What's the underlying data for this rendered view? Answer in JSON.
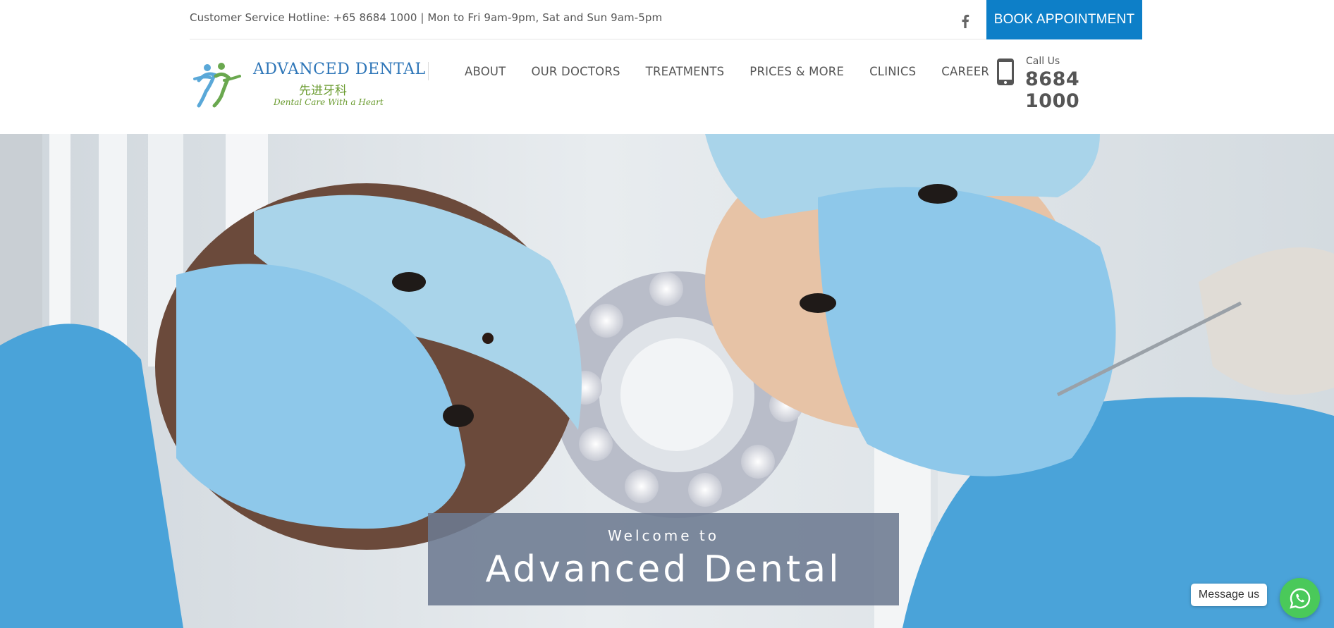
{
  "topbar": {
    "hotline": "Customer Service Hotline: +65 8684 1000 | Mon to Fri 9am-9pm, Sat and Sun 9am-5pm",
    "social_icon": "facebook-icon",
    "book_label": "BOOK APPOINTMENT"
  },
  "header": {
    "logo": {
      "name": "ADVANCED DENTAL",
      "chinese": "先进牙科",
      "tagline": "Dental Care With a Heart"
    },
    "nav": [
      {
        "label": "ABOUT"
      },
      {
        "label": "OUR DOCTORS"
      },
      {
        "label": "TREATMENTS"
      },
      {
        "label": "PRICES & MORE"
      },
      {
        "label": "CLINICS"
      },
      {
        "label": "CAREER"
      }
    ],
    "call": {
      "icon": "mobile-phone-icon",
      "label": "Call Us",
      "number": "8684 1000"
    }
  },
  "hero": {
    "welcome_small": "Welcome to",
    "welcome_big": "Advanced Dental"
  },
  "chat": {
    "bubble": "Message us",
    "icon": "whatsapp-icon"
  },
  "colors": {
    "accent": "#0d7fc8",
    "whatsapp": "#4ac95a",
    "overlay": "#6c7a91"
  }
}
